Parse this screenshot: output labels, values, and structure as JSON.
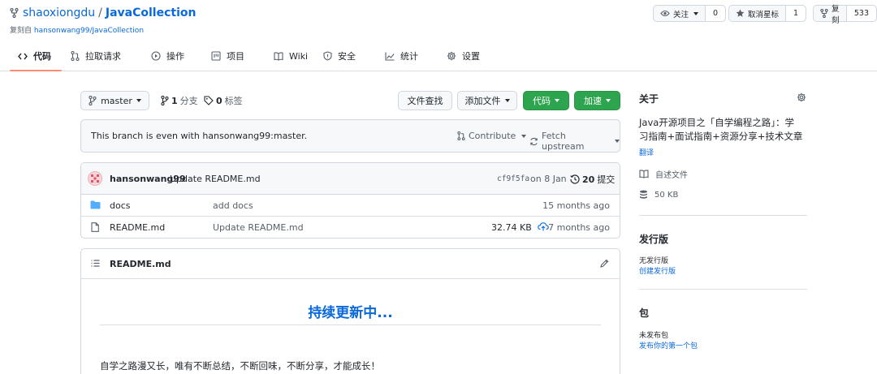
{
  "repo": {
    "owner": "shaoxiongdu",
    "separator": "/",
    "name": "JavaCollection",
    "forked_prefix": "复刻自",
    "forked_from": "hansonwang99/JavaCollection"
  },
  "header_buttons": {
    "watch": {
      "label": "关注",
      "count": "0"
    },
    "star": {
      "label": "取消星标",
      "count": "1"
    },
    "fork": {
      "label": "复刻",
      "count": "533"
    }
  },
  "tabs": [
    {
      "label": "代码",
      "icon": "code-icon"
    },
    {
      "label": "拉取请求",
      "icon": "pull-request-icon"
    },
    {
      "label": "操作",
      "icon": "play-icon"
    },
    {
      "label": "项目",
      "icon": "project-icon"
    },
    {
      "label": "Wiki",
      "icon": "book-icon"
    },
    {
      "label": "安全",
      "icon": "shield-icon"
    },
    {
      "label": "统计",
      "icon": "graph-icon"
    },
    {
      "label": "设置",
      "icon": "gear-icon"
    }
  ],
  "toolbar": {
    "branch": "master",
    "branch_count": "1",
    "branch_label": "分支",
    "tag_count": "0",
    "tag_label": "标签",
    "find_file": "文件查找",
    "add_file": "添加文件",
    "code": "代码",
    "speed": "加速"
  },
  "branch_info": {
    "text": "This branch is even with hansonwang99:master.",
    "contribute": "Contribute",
    "fetch_upstream": "Fetch upstream"
  },
  "commit": {
    "author": "hansonwang99",
    "message": "Update README.md",
    "hash": "cf9f5fa",
    "date": "on 8 Jan",
    "count": "20",
    "count_label": "提交"
  },
  "files": [
    {
      "name": "docs",
      "type": "folder",
      "message": "add docs",
      "size": "",
      "time": "15 months ago"
    },
    {
      "name": "README.md",
      "type": "file",
      "message": "Update README.md",
      "size": "32.74 KB",
      "time": "7 months ago"
    }
  ],
  "readme": {
    "title": "README.md",
    "heading": "持续更新中...",
    "line1": "自学之路漫又长，唯有不断总结，不断回味，不断分享，才能成长！"
  },
  "sidebar": {
    "about_title": "关于",
    "description": [
      "Java开源项目之「自学编程之路」：学",
      "习指南+面试指南+资源分享+技术文章"
    ],
    "translate": "翻译",
    "readme_label": "自述文件",
    "size_label": "50 KB",
    "releases_title": "发行版",
    "no_releases": "无发行版",
    "create_release": "创建发行版",
    "packages_title": "包",
    "no_packages": "未发布包",
    "publish_package": "发布你的第一个包"
  },
  "colors": {
    "link": "#0969da",
    "green": "#2da44e",
    "tab_underline": "#fd8c73",
    "border": "#d0d7de"
  }
}
